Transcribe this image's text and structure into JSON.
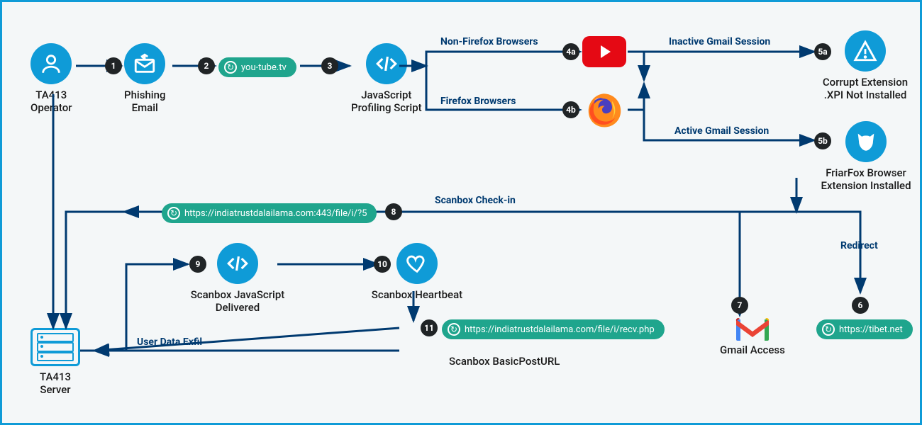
{
  "nodes": {
    "operator": "TA413\nOperator",
    "phish": "Phishing\nEmail",
    "js": "JavaScript\nProfiling Script",
    "corrupt": "Corrupt Extension\n.XPI Not Installed",
    "friarfox": "FriarFox Browser\nExtension Installed",
    "scanbox_js": "Scanbox JavaScript\nDelivered",
    "heartbeat": "Scanbox Heartbeat",
    "basicpost": "Scanbox BasicPostURL",
    "gmail": "Gmail Access",
    "server": "TA413\nServer"
  },
  "badges": {
    "b1": "1",
    "b2": "2",
    "b3": "3",
    "b4a": "4a",
    "b4b": "4b",
    "b5a": "5a",
    "b5b": "5b",
    "b6": "6",
    "b7": "7",
    "b8": "8",
    "b9": "9",
    "b10": "10",
    "b11": "11"
  },
  "pills": {
    "p2": "you-tube.tv",
    "p6": "https://tibet.net",
    "p8": "https://indiatrustdalailama.com:443/file/i/?5",
    "p11": "https://indiatrustdalailama.com/file/i/recv.php"
  },
  "edge_labels": {
    "nonff": "Non-Firefox Browsers",
    "ff": "Firefox Browsers",
    "inactive": "Inactive Gmail Session",
    "active": "Active Gmail Session",
    "redirect": "Redirect",
    "checkin": "Scanbox Check-in",
    "exfil": "User Data Exfil"
  },
  "colors": {
    "accent": "#0f9bd7",
    "pill": "#1fa58d",
    "badge": "#202426",
    "label": "#003a70"
  }
}
